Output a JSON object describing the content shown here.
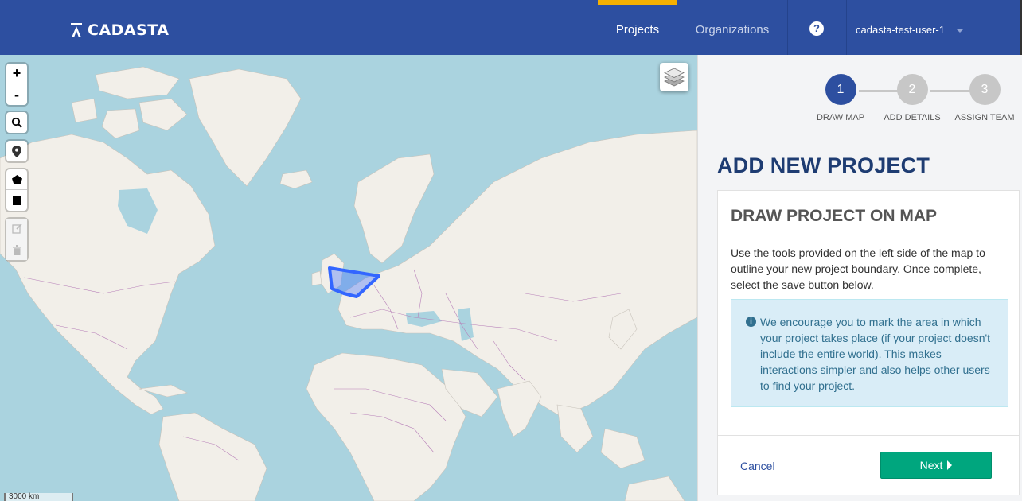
{
  "header": {
    "brand": "CADASTA",
    "nav": {
      "projects": "Projects",
      "organizations": "Organizations"
    },
    "help_icon": "question-circle-icon",
    "user": "cadasta-test-user-1",
    "accent_color": "#f5b000",
    "bar_color": "#2d4fa0"
  },
  "map": {
    "controls": {
      "zoom_in": "+",
      "zoom_out": "-",
      "search_icon": "search-icon",
      "marker_icon": "map-marker-icon",
      "polygon_icon": "polygon-icon",
      "rectangle_icon": "rectangle-icon",
      "edit_icon": "edit-icon",
      "delete_icon": "trash-icon",
      "layers_icon": "layers-icon"
    },
    "scale": "3000 km"
  },
  "wizard": {
    "steps": [
      {
        "number": "1",
        "label": "DRAW MAP",
        "active": true
      },
      {
        "number": "2",
        "label": "ADD DETAILS",
        "active": false
      },
      {
        "number": "3",
        "label": "ASSIGN TEAM",
        "active": false
      }
    ],
    "page_title": "ADD NEW PROJECT",
    "card_title": "DRAW PROJECT ON MAP",
    "instructions": "Use the tools provided on the left side of the map to outline your new project boundary. Once complete, select the save button below.",
    "info": "We encourage you to mark the area in which your project takes place (if your project doesn't include the entire world). This makes interactions simpler and also helps other users to find your project.",
    "cancel_label": "Cancel",
    "next_label": "Next"
  }
}
